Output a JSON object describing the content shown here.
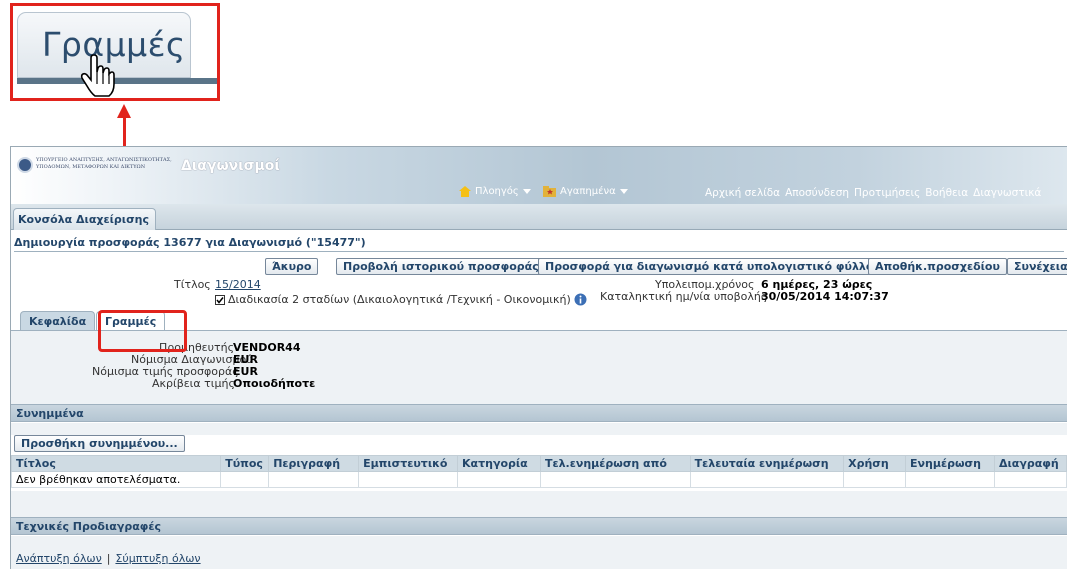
{
  "zoom": {
    "tab_label": "Γραμμές"
  },
  "header": {
    "logo_text": "ΥΠΟΥΡΓΕΙΟ ΑΝΑΠΤΥΞΗΣ, ΑΝΤΑΓΩΝΙΣΤΙΚΟΤΗΤΑΣ, ΥΠΟΔΟΜΩΝ, ΜΕΤΑΦΟΡΩΝ ΚΑΙ ΔΙΚΤΥΩΝ",
    "app_title": "Διαγωνισμοί",
    "navigator": "Πλοηγός",
    "favorites": "Αγαπημένα",
    "links": [
      "Αρχική σελίδα",
      "Αποσύνδεση",
      "Προτιμήσεις",
      "Βοήθεια",
      "Διαγνωστικά"
    ],
    "console_tab": "Κονσόλα Διαχείρισης"
  },
  "page": {
    "heading": "Δημιουργία προσφοράς 13677 για Διαγωνισμό (\"15477\")",
    "buttons": {
      "cancel": "Άκυρο",
      "history": "Προβολή ιστορικού προσφοράς",
      "spreadsheet": "Προσφορά για διαγωνισμό κατά υπολογιστικό φύλλο",
      "save_draft": "Αποθήκ.προσχεδίου",
      "continue": "Συνέχεια"
    },
    "title_label": "Τίτλος",
    "title_value": "15/2014",
    "two_stage_label": "Διαδικασία 2 σταδίων (Δικαιολογητικά /Τεχνική - Οικονομική)",
    "remaining_label": "Υπολειπομ.χρόνος",
    "remaining_value": "6 ημέρες, 23 ώρες",
    "deadline_label": "Καταληκτική ημ/νία υποβολής",
    "deadline_value": "30/05/2014 14:07:37"
  },
  "tabs": {
    "header": "Κεφαλίδα",
    "lines": "Γραμμές"
  },
  "details": {
    "supplier_label": "Προμηθευτής",
    "supplier_value": "VENDOR44",
    "auction_currency_label": "Νόμισμα Διαγωνισμού",
    "auction_currency_value": "EUR",
    "bid_currency_label": "Νόμισμα τιμής προσφοράς",
    "bid_currency_value": "EUR",
    "price_precision_label": "Ακρίβεια τιμής",
    "price_precision_value": "Οποιοδήποτε"
  },
  "attachments": {
    "section_title": "Συνημμένα",
    "add_button": "Προσθήκη συνημμένου...",
    "columns": [
      "Τίτλος",
      "Τύπος",
      "Περιγραφή",
      "Εμπιστευτικό",
      "Κατηγορία",
      "Τελ.ενημέρωση από",
      "Τελευταία ενημέρωση",
      "Χρήση",
      "Ενημέρωση",
      "Διαγραφή"
    ],
    "empty_message": "Δεν βρέθηκαν αποτελέσματα."
  },
  "tech_specs": {
    "section_title": "Τεχνικές Προδιαγραφές",
    "expand_all": "Ανάπτυξη όλων",
    "collapse_all": "Σύμπτυξη όλων"
  },
  "colors": {
    "highlight": "#e1231c",
    "link": "#23466a",
    "header_band": "#c9d8e3"
  }
}
